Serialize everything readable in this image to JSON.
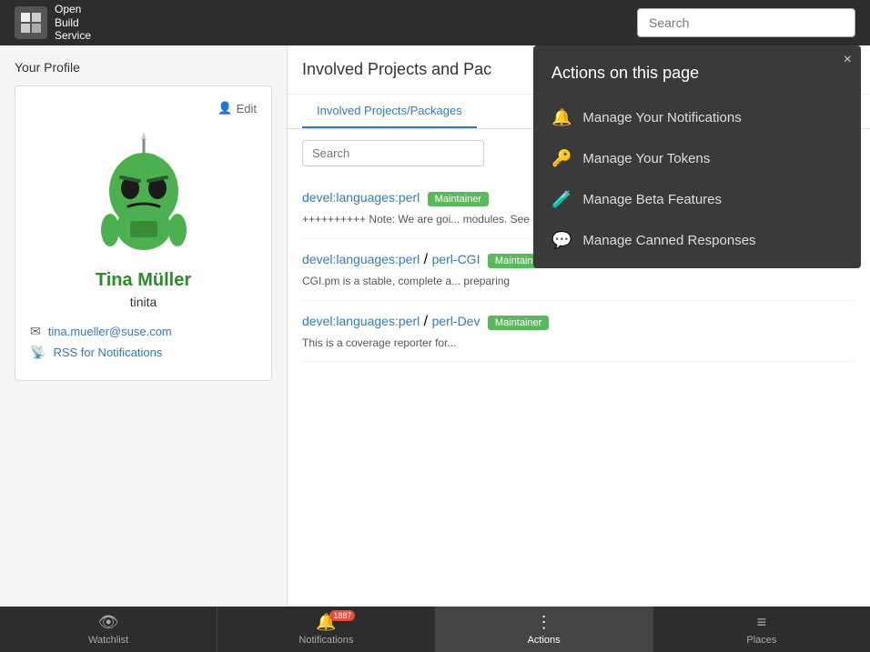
{
  "header": {
    "logo_lines": [
      "Open",
      "Build",
      "Service"
    ],
    "search_placeholder": "Search"
  },
  "profile": {
    "heading": "Your Profile",
    "edit_label": "Edit",
    "user_name": "Tina Müller",
    "user_login": "tinita",
    "email": "tina.mueller@suse.com",
    "rss_label": "RSS for Notifications"
  },
  "projects_section": {
    "title": "Involved Projects and Pac",
    "tabs": [
      {
        "label": "Involved Projects/Packages",
        "active": true
      }
    ],
    "search_placeholder": "Search",
    "items": [
      {
        "link": "devel:languages:perl",
        "badge": "Maintainer",
        "desc": "++++++++++ Note: We are goi... modules. See https://github.co..."
      },
      {
        "link1": "devel:languages:perl",
        "sep": "/",
        "link2": "perl-CGI",
        "badge": "Maintainer",
        "desc": "CGI.pm is a stable, complete a... preparing"
      },
      {
        "link1": "devel:languages:perl",
        "sep": "/",
        "link2": "perl-Dev",
        "badge": "Maintainer",
        "desc": "This is a coverage reporter for..."
      }
    ]
  },
  "actions_panel": {
    "title": "Actions on this page",
    "close_label": "×",
    "items": [
      {
        "icon": "bell",
        "label": "Manage Your Notifications"
      },
      {
        "icon": "key",
        "label": "Manage Your Tokens"
      },
      {
        "icon": "flask",
        "label": "Manage Beta Features"
      },
      {
        "icon": "comment",
        "label": "Manage Canned Responses"
      }
    ]
  },
  "bottom_nav": {
    "items": [
      {
        "icon": "eye",
        "label": "Watchlist"
      },
      {
        "icon": "bell",
        "label": "Notifications",
        "badge": "1887"
      },
      {
        "icon": "dots",
        "label": "Actions",
        "active": true
      },
      {
        "icon": "lines",
        "label": "Places"
      }
    ]
  }
}
